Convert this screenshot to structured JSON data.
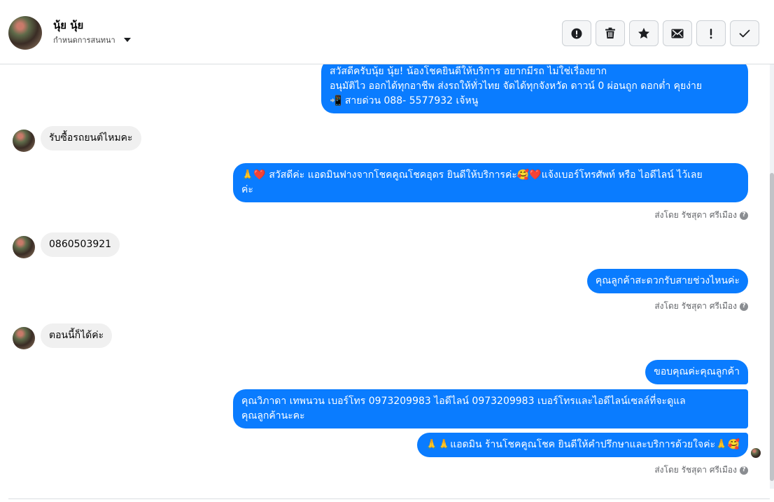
{
  "header": {
    "name": "นุ้ย นุ้ย",
    "assign_label": "กำหนดการสนทนา"
  },
  "toolbar": {
    "buttons": [
      {
        "icon": "alert-circle-icon"
      },
      {
        "icon": "trash-icon"
      },
      {
        "icon": "star-icon"
      },
      {
        "icon": "envelope-icon"
      },
      {
        "icon": "exclamation-icon"
      },
      {
        "icon": "check-icon"
      }
    ]
  },
  "messages": [
    {
      "side": "out",
      "lines": [
        "สวัสดีครับนุ้ย นุ้ย! น้องโชคยินดีให้บริการ อยากมีรถ ไม่ใช่เรื่องยาก",
        "อนุมัติไว ออกได้ทุกอาชีพ ส่งรถให้ทั่วไทย จัดได้ทุกจังหวัด ดาวน์ 0  ผ่อนถูก ดอกต่ำ คุยง่าย",
        "📲 สายด่วน 088- 5577932 เจ้หนู"
      ]
    },
    {
      "side": "in",
      "text": "รับซื้อรถยนต์ไหมคะ"
    },
    {
      "side": "out",
      "lines": [
        "🙏❤️ สวัสดีค่ะ แอดมินฟางจากโชคคูณโชคอุดร ยินดีให้บริการค่ะ🥰❤️แจ้งเบอร์โทรศัพท์ หรือ ไอดีไลน์  ไว้เลย",
        "ค่ะ"
      ]
    },
    {
      "side": "in",
      "text": "0860503921"
    },
    {
      "side": "out",
      "text": "คุณลูกค้าสะดวกรับสายช่วงไหนค่ะ"
    },
    {
      "side": "in",
      "text": "ตอนนี้ก็ได้ค่ะ"
    },
    {
      "side": "out",
      "text": "ขอบคุณค่ะคุณลูกค้า"
    },
    {
      "side": "out",
      "lines": [
        "คุณวิภาดา เทพนวน        เบอร์โทร 0973209983  ไอดีไลน์ 0973209983  เบอร์โทรและไอดีไลน์เซลล์ที่จะดูแล",
        "คุณลูกค้านะคะ"
      ]
    },
    {
      "side": "out",
      "text": "🙏🙏แอดมิน ร้านโชคคูณโชค ยินดีให้คำปรึกษาและบริการด้วยใจค่ะ🙏🥰"
    }
  ],
  "sent_by": "ส่งโดย รัชสุดา ศรีเมือง",
  "help_glyph": "?"
}
